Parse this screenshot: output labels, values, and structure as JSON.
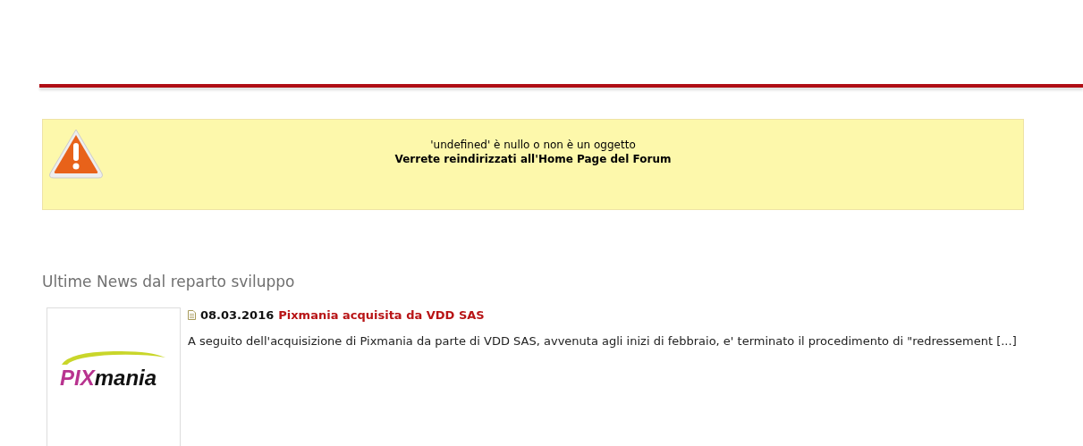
{
  "alert": {
    "message": "'undefined' è nullo o non è un oggetto",
    "redirect": "Verrete reindirizzati all'Home Page del Forum"
  },
  "news_section": {
    "title": "Ultime News dal reparto sviluppo",
    "items": [
      {
        "logo": {
          "part_1": "PIX",
          "part_2": "mania"
        },
        "date": "08.03.2016",
        "headline": "Pixmania acquisita da VDD SAS",
        "summary": "A seguito dell'acquisizione di Pixmania da parte di VDD SAS, avvenuta agli inizi di febbraio, e' terminato il procedimento di \"redressement [...]"
      }
    ]
  }
}
